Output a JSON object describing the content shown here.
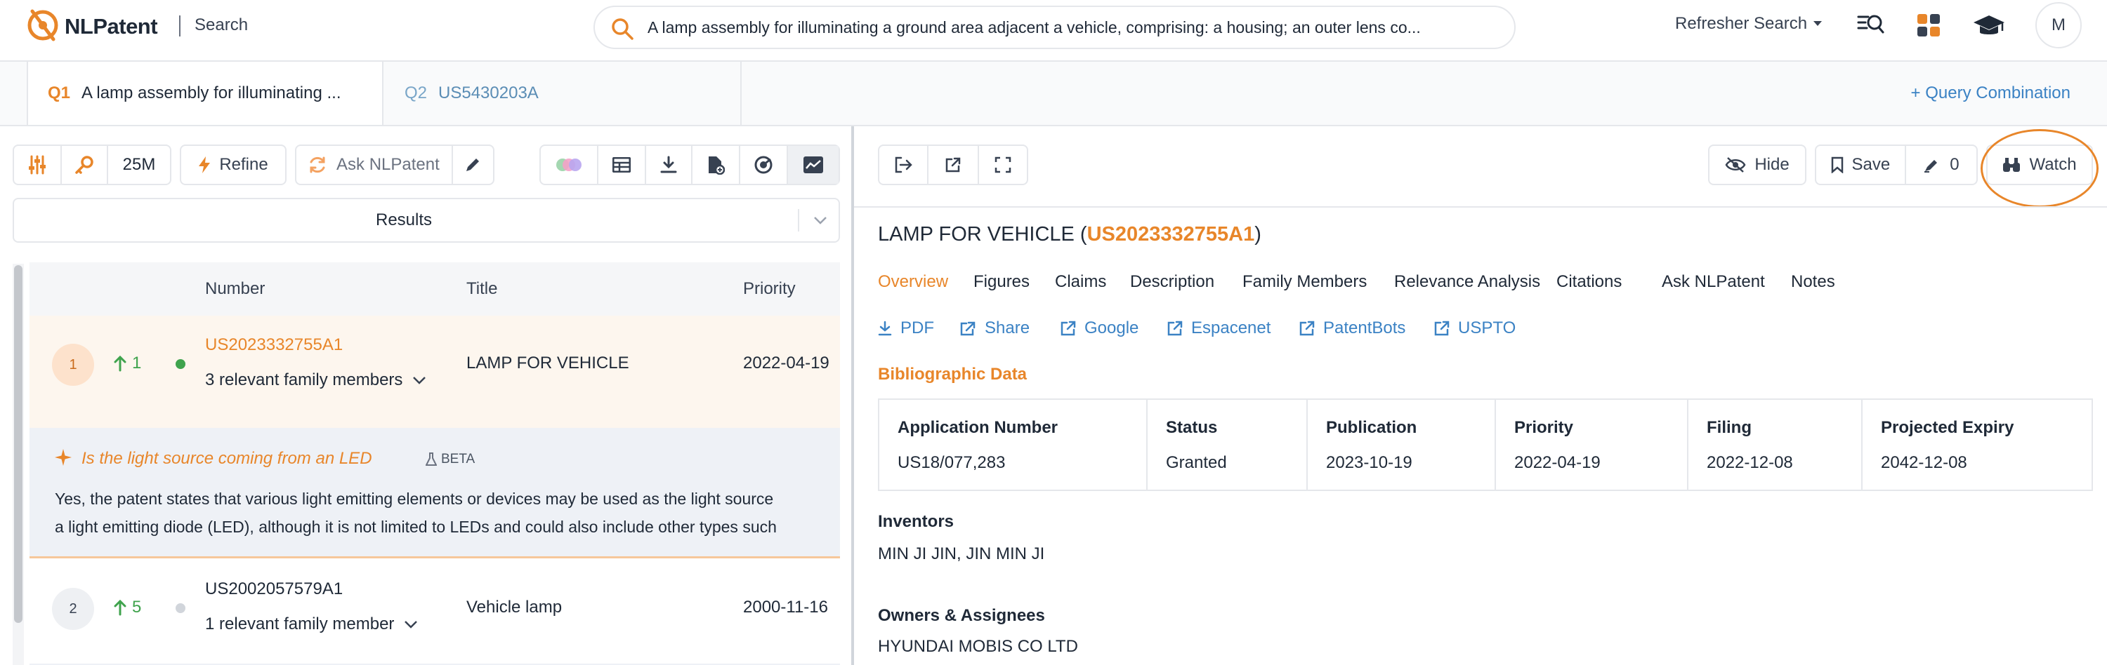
{
  "app": {
    "brand_name": "NLPatent",
    "section": "Search"
  },
  "search": {
    "query": "A lamp assembly for illuminating a ground area adjacent a vehicle, comprising: a housing; an outer lens co..."
  },
  "nav": {
    "refresher_search": "Refresher Search",
    "avatar_initial": "M"
  },
  "query_tabs": [
    {
      "num": "Q1",
      "label": "A lamp assembly for illuminating ..."
    },
    {
      "num": "Q2",
      "label": "US5430203A"
    }
  ],
  "query_combination": "+ Query Combination",
  "toolbar": {
    "count": "25M",
    "refine": "Refine",
    "ask": "Ask NLPatent"
  },
  "results_select": "Results",
  "table": {
    "headers": {
      "number": "Number",
      "title": "Title",
      "priority": "Priority"
    },
    "rows": [
      {
        "rank": "1",
        "movement": "1",
        "number": "US2023332755A1",
        "family": "3 relevant family members",
        "title": "LAMP FOR VEHICLE",
        "priority": "2022-04-19"
      },
      {
        "rank": "2",
        "movement": "5",
        "number": "US2002057579A1",
        "family": "1 relevant family member",
        "title": "Vehicle lamp",
        "priority": "2000-11-16"
      }
    ],
    "ai_answer": {
      "question": "Is the light source coming from an LED",
      "badge": "BETA",
      "line1": "Yes, the patent states that various light emitting elements or devices may be used as the light source",
      "line2": "a light emitting diode (LED), although it is not limited to LEDs and could also include other types such"
    }
  },
  "detail": {
    "actions": {
      "hide": "Hide",
      "save": "Save",
      "annotations": "0",
      "watch": "Watch"
    },
    "title_prefix": "LAMP FOR VEHICLE (",
    "title_number": "US2023332755A1",
    "title_suffix": ")",
    "tabs": [
      "Overview",
      "Figures",
      "Claims",
      "Description",
      "Family Members",
      "Relevance Analysis",
      "Citations",
      "Ask NLPatent",
      "Notes"
    ],
    "links": [
      "PDF",
      "Share",
      "Google",
      "Espacenet",
      "PatentBots",
      "USPTO"
    ],
    "bibliographic_title": "Bibliographic Data",
    "bibliographic": [
      {
        "label": "Application Number",
        "value": "US18/077,283"
      },
      {
        "label": "Status",
        "value": "Granted"
      },
      {
        "label": "Publication",
        "value": "2023-10-19"
      },
      {
        "label": "Priority",
        "value": "2022-04-19"
      },
      {
        "label": "Filing",
        "value": "2022-12-08"
      },
      {
        "label": "Projected Expiry",
        "value": "2042-12-08"
      }
    ],
    "inventors_label": "Inventors",
    "inventors": "MIN JI JIN, JIN MIN JI",
    "owners_label": "Owners & Assignees",
    "owners": "HYUNDAI MOBIS CO LTD"
  },
  "colors": {
    "accent_orange": "#e8862a",
    "link_blue": "#3b82c4",
    "green": "#3fa34d"
  }
}
